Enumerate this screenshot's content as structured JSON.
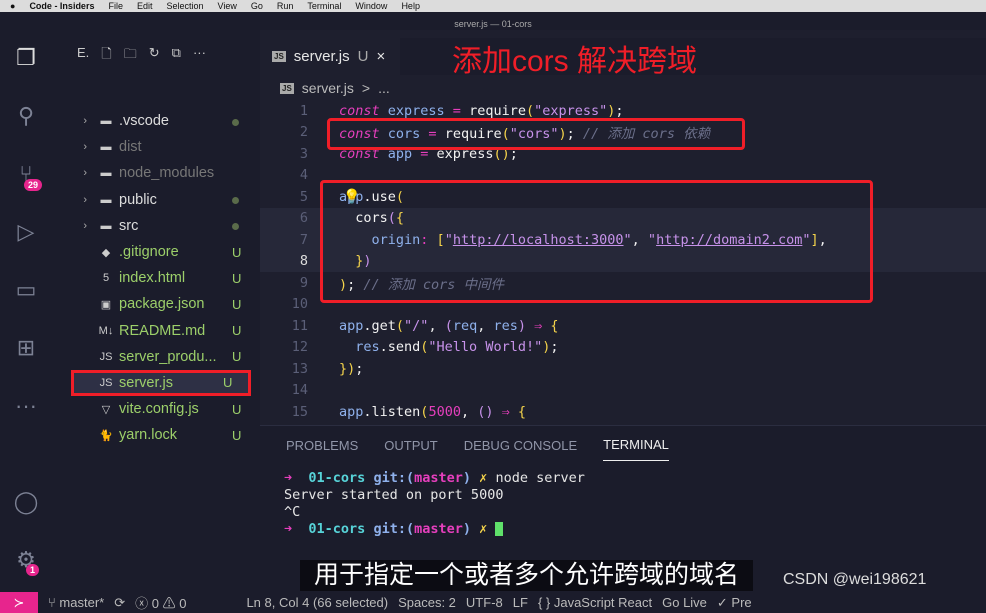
{
  "menubar": {
    "app": "Code - Insiders",
    "items": [
      "File",
      "Edit",
      "Selection",
      "View",
      "Go",
      "Run",
      "Terminal",
      "Window",
      "Help"
    ]
  },
  "window_title": "server.js — 01-cors",
  "activity": {
    "scm_badge": "29",
    "settings_badge": "1"
  },
  "sidebar": {
    "title": "E.",
    "items": [
      {
        "name": ".vscode",
        "type": "folder",
        "status": "dot"
      },
      {
        "name": "dist",
        "type": "folder",
        "status": ""
      },
      {
        "name": "node_modules",
        "type": "folder",
        "status": ""
      },
      {
        "name": "public",
        "type": "folder",
        "status": "dot"
      },
      {
        "name": "src",
        "type": "folder",
        "status": "dot"
      },
      {
        "name": ".gitignore",
        "type": "file",
        "icon": "◆",
        "status": "U"
      },
      {
        "name": "index.html",
        "type": "file",
        "icon": "5",
        "status": "U"
      },
      {
        "name": "package.json",
        "type": "file",
        "icon": "▣",
        "status": "U"
      },
      {
        "name": "README.md",
        "type": "file",
        "icon": "M↓",
        "status": "U"
      },
      {
        "name": "server_produ...",
        "type": "file",
        "icon": "JS",
        "status": "U"
      },
      {
        "name": "server.js",
        "type": "file",
        "icon": "JS",
        "status": "U",
        "selected": true
      },
      {
        "name": "vite.config.js",
        "type": "file",
        "icon": "▽",
        "status": "U"
      },
      {
        "name": "yarn.lock",
        "type": "file",
        "icon": "🐈",
        "status": "U"
      }
    ]
  },
  "tab": {
    "label": "server.js",
    "status": "U",
    "close": "×"
  },
  "overlay_title": "添加cors 解决跨域",
  "breadcrumb": {
    "file": "server.js",
    "sep": ">",
    "rest": "..."
  },
  "code": [
    [
      [
        "const",
        "k"
      ],
      [
        " express ",
        "v"
      ],
      [
        "=",
        "o"
      ],
      [
        " require",
        "f"
      ],
      [
        "(",
        "p"
      ],
      [
        "\"express\"",
        "s"
      ],
      [
        ")",
        "p"
      ],
      [
        ";",
        "f"
      ]
    ],
    [
      [
        "const",
        "k"
      ],
      [
        " cors ",
        "v"
      ],
      [
        "=",
        "o"
      ],
      [
        " require",
        "f"
      ],
      [
        "(",
        "p"
      ],
      [
        "\"cors\"",
        "s"
      ],
      [
        ")",
        "p"
      ],
      [
        "; ",
        "f"
      ],
      [
        "// 添加 cors 依赖",
        "c"
      ]
    ],
    [
      [
        "const",
        "k"
      ],
      [
        " app ",
        "v"
      ],
      [
        "=",
        "o"
      ],
      [
        " express",
        "f"
      ],
      [
        "()",
        "p"
      ],
      [
        ";",
        "f"
      ]
    ],
    [],
    [
      [
        "app",
        "v"
      ],
      [
        ".use",
        "f"
      ],
      [
        "(",
        "p"
      ]
    ],
    [
      [
        "  cors",
        "f"
      ],
      [
        "(",
        "s"
      ],
      [
        "{",
        "p"
      ]
    ],
    [
      [
        "    origin",
        "pr"
      ],
      [
        ": ",
        "o"
      ],
      [
        "[",
        "p"
      ],
      [
        "\"",
        "s"
      ],
      [
        "http://localhost:3000",
        "u"
      ],
      [
        "\"",
        "s"
      ],
      [
        ", ",
        "f"
      ],
      [
        "\"",
        "s"
      ],
      [
        "http://domain2.com",
        "u"
      ],
      [
        "\"",
        "s"
      ],
      [
        "]",
        "p"
      ],
      [
        ",",
        "f"
      ]
    ],
    [
      [
        "  }",
        "p"
      ],
      [
        ")",
        "s"
      ]
    ],
    [
      [
        ")",
        "p"
      ],
      [
        "; ",
        "f"
      ],
      [
        "// 添加 cors 中间件",
        "c"
      ]
    ],
    [],
    [
      [
        "app",
        "v"
      ],
      [
        ".get",
        "f"
      ],
      [
        "(",
        "p"
      ],
      [
        "\"/\"",
        "s"
      ],
      [
        ", ",
        "f"
      ],
      [
        "(",
        "s"
      ],
      [
        "req",
        "v"
      ],
      [
        ", ",
        "f"
      ],
      [
        "res",
        "v"
      ],
      [
        ")",
        "s"
      ],
      [
        " ⇒ ",
        "o"
      ],
      [
        "{",
        "p"
      ]
    ],
    [
      [
        "  res",
        "v"
      ],
      [
        ".send",
        "f"
      ],
      [
        "(",
        "p"
      ],
      [
        "\"Hello World!\"",
        "s"
      ],
      [
        ")",
        "p"
      ],
      [
        ";",
        "f"
      ]
    ],
    [
      [
        "}",
        "p"
      ],
      [
        ")",
        "p"
      ],
      [
        ";",
        "f"
      ]
    ],
    [],
    [
      [
        "app",
        "v"
      ],
      [
        ".listen",
        "f"
      ],
      [
        "(",
        "p"
      ],
      [
        "5000",
        "n"
      ],
      [
        ", ",
        "f"
      ],
      [
        "()",
        "s"
      ],
      [
        " ⇒ ",
        "o"
      ],
      [
        "{",
        "p"
      ]
    ]
  ],
  "current_line": 8,
  "panel": {
    "tabs": [
      "PROBLEMS",
      "OUTPUT",
      "DEBUG CONSOLE",
      "TERMINAL"
    ],
    "active": "TERMINAL",
    "terminal": {
      "arrow": "➜",
      "dir": "01-cors",
      "git": "git:(",
      "branch": "master",
      "git_close": ")",
      "x": "✗",
      "cmd": "node server",
      "out1": "Server started on port 5000",
      "out2": "^C"
    }
  },
  "status": {
    "branch": "master*",
    "errors": "0",
    "warnings": "0",
    "position": "Ln 8, Col 4 (66 selected)",
    "spaces": "Spaces: 2",
    "encoding": "UTF-8",
    "eol": "LF",
    "language": "{ } JavaScript React",
    "golive": "Go Live",
    "prettier": "✓ Pre"
  },
  "subtitle": "用于指定一个或者多个允许跨域的域名",
  "watermark": "CSDN @wei198621"
}
